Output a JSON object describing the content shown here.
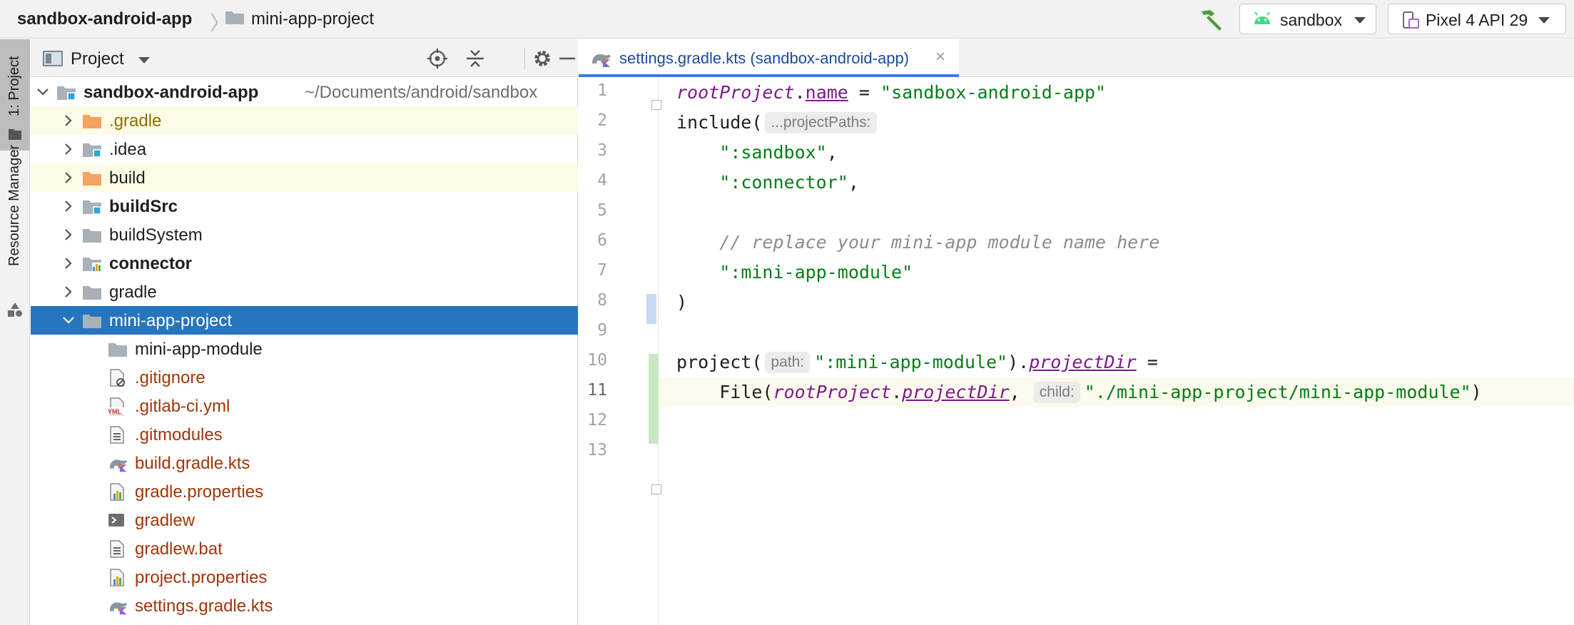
{
  "navbar": {
    "breadcrumb_root": "sandbox-android-app",
    "breadcrumb_child": "mini-app-project",
    "run_config": "sandbox",
    "device": "Pixel 4 API 29",
    "hammer_icon": "build-hammer-icon",
    "android_icon": "android-icon",
    "device_icon": "phone-device-icon"
  },
  "left_strip": {
    "project_tab": "1: Project",
    "resource_manager_tab": "Resource Manager"
  },
  "project_panel": {
    "title": "Project",
    "tools": [
      "locate-icon",
      "collapse-icon",
      "gear-icon",
      "hide-icon"
    ],
    "root": {
      "name": "sandbox-android-app",
      "path": "~/Documents/android/sandbox"
    },
    "items": [
      {
        "name": ".gradle",
        "style": "excluded",
        "icon": "folder-orange"
      },
      {
        "name": ".idea",
        "style": "normal",
        "icon": "folder-blue-square"
      },
      {
        "name": "build",
        "style": "normal-excluded",
        "icon": "folder-orange"
      },
      {
        "name": "buildSrc",
        "style": "bold",
        "icon": "folder-blue-square"
      },
      {
        "name": "buildSystem",
        "style": "normal",
        "icon": "folder-gray"
      },
      {
        "name": "connector",
        "style": "bold",
        "icon": "folder-module"
      },
      {
        "name": "gradle",
        "style": "normal",
        "icon": "folder-gray"
      },
      {
        "name": "mini-app-project",
        "style": "selected",
        "icon": "folder-gray"
      },
      {
        "name": "mini-app-module",
        "style": "normal",
        "icon": "folder-gray"
      },
      {
        "name": ".gitignore",
        "style": "vcs",
        "icon": "file-ignore"
      },
      {
        "name": ".gitlab-ci.yml",
        "style": "vcs",
        "icon": "file-yml"
      },
      {
        "name": ".gitmodules",
        "style": "vcs",
        "icon": "file-text"
      },
      {
        "name": "build.gradle.kts",
        "style": "vcs",
        "icon": "file-gradle"
      },
      {
        "name": "gradle.properties",
        "style": "vcs",
        "icon": "file-properties"
      },
      {
        "name": "gradlew",
        "style": "vcs",
        "icon": "file-shell"
      },
      {
        "name": "gradlew.bat",
        "style": "vcs",
        "icon": "file-text"
      },
      {
        "name": "project.properties",
        "style": "vcs",
        "icon": "file-properties"
      },
      {
        "name": "settings.gradle.kts",
        "style": "vcs",
        "icon": "file-gradle"
      }
    ]
  },
  "editor": {
    "tab_label": "settings.gradle.kts (sandbox-android-app)",
    "line_numbers": [
      "1",
      "2",
      "3",
      "4",
      "5",
      "6",
      "7",
      "8",
      "9",
      "10",
      "11",
      "12",
      "13"
    ],
    "code": {
      "l1_root": "rootProject",
      "l1_dot": ".",
      "l1_name": "name",
      "l1_eq": " = ",
      "l1_str": "\"sandbox-android-app\"",
      "l2_fn": "include(",
      "l2_hint": "...projectPaths:",
      "l3_str": "\":sandbox\"",
      "l3_comma": ",",
      "l4_str": "\":connector\"",
      "l4_comma": ",",
      "l6_cmt": "// replace your mini-app module name here",
      "l7_str": "\":mini-app-module\"",
      "l8_close": ")",
      "l10_fn": "project(",
      "l10_hint": "path:",
      "l10_str": "\":mini-app-module\"",
      "l10_close": ").",
      "l10_prop": "projectDir",
      "l10_eq": " =",
      "l11_fn": "File(",
      "l11_root": "rootProject",
      "l11_dot": ".",
      "l11_prop": "projectDir",
      "l11_comma": ",",
      "l11_hint": "child:",
      "l11_str": "\"./mini-app-project/mini-app-module\"",
      "l11_close": ")"
    }
  }
}
